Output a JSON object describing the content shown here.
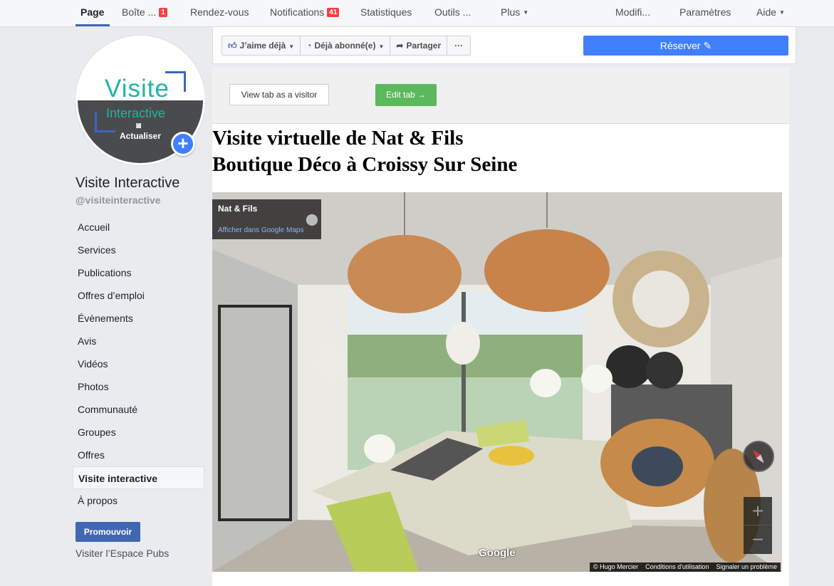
{
  "topnav": {
    "page": "Page",
    "inbox": "Boîte ...",
    "inbox_badge": "1",
    "appointments": "Rendez-vous",
    "notifications": "Notifications",
    "notifications_badge": "41",
    "stats": "Statistiques",
    "tools": "Outils ...",
    "more": "Plus",
    "edit": "Modifi...",
    "settings": "Paramètres",
    "help": "Aide"
  },
  "profile": {
    "logo_word": "Visite",
    "logo_sub": "Interactive",
    "update_label": "Actualiser",
    "name": "Visite Interactive",
    "handle": "@visiteinteractive"
  },
  "sidenav": {
    "items": [
      {
        "label": "Accueil"
      },
      {
        "label": "Services"
      },
      {
        "label": "Publications"
      },
      {
        "label": "Offres d’emploi"
      },
      {
        "label": "Évènements"
      },
      {
        "label": "Avis"
      },
      {
        "label": "Vidéos"
      },
      {
        "label": "Photos"
      },
      {
        "label": "Communauté"
      },
      {
        "label": "Groupes"
      },
      {
        "label": "Offres"
      },
      {
        "label": "Visite interactive"
      },
      {
        "label": "À propos"
      }
    ],
    "active_index": 11,
    "promote": "Promouvoir",
    "ads_link": "Visiter l’Espace Pubs"
  },
  "actionbar": {
    "like": "J’aime déjà",
    "follow": "Déjà abonné(e)",
    "share": "Partager",
    "more": "···",
    "reserve": "Réserver"
  },
  "tab": {
    "view_as_visitor": "View tab as a visitor",
    "edit_tab": "Edit tab →"
  },
  "content": {
    "title_line1": "Visite virtuelle de Nat & Fils",
    "title_line2": "Boutique Déco à Croissy Sur Seine"
  },
  "streetview": {
    "place": "Nat & Fils",
    "maps_link": "Afficher dans Google Maps",
    "zoom_in": "+",
    "zoom_out": "−",
    "watermark": "Google",
    "credit": "© Hugo Mercier",
    "terms": "Conditions d'utilisation",
    "report": "Signaler un problème"
  },
  "colors": {
    "brand_blue": "#4267b2",
    "reserve_blue": "#4080ff",
    "edit_green": "#5cb85c",
    "badge_red": "#fa3e3e",
    "logo_teal": "#1fb5a6"
  }
}
